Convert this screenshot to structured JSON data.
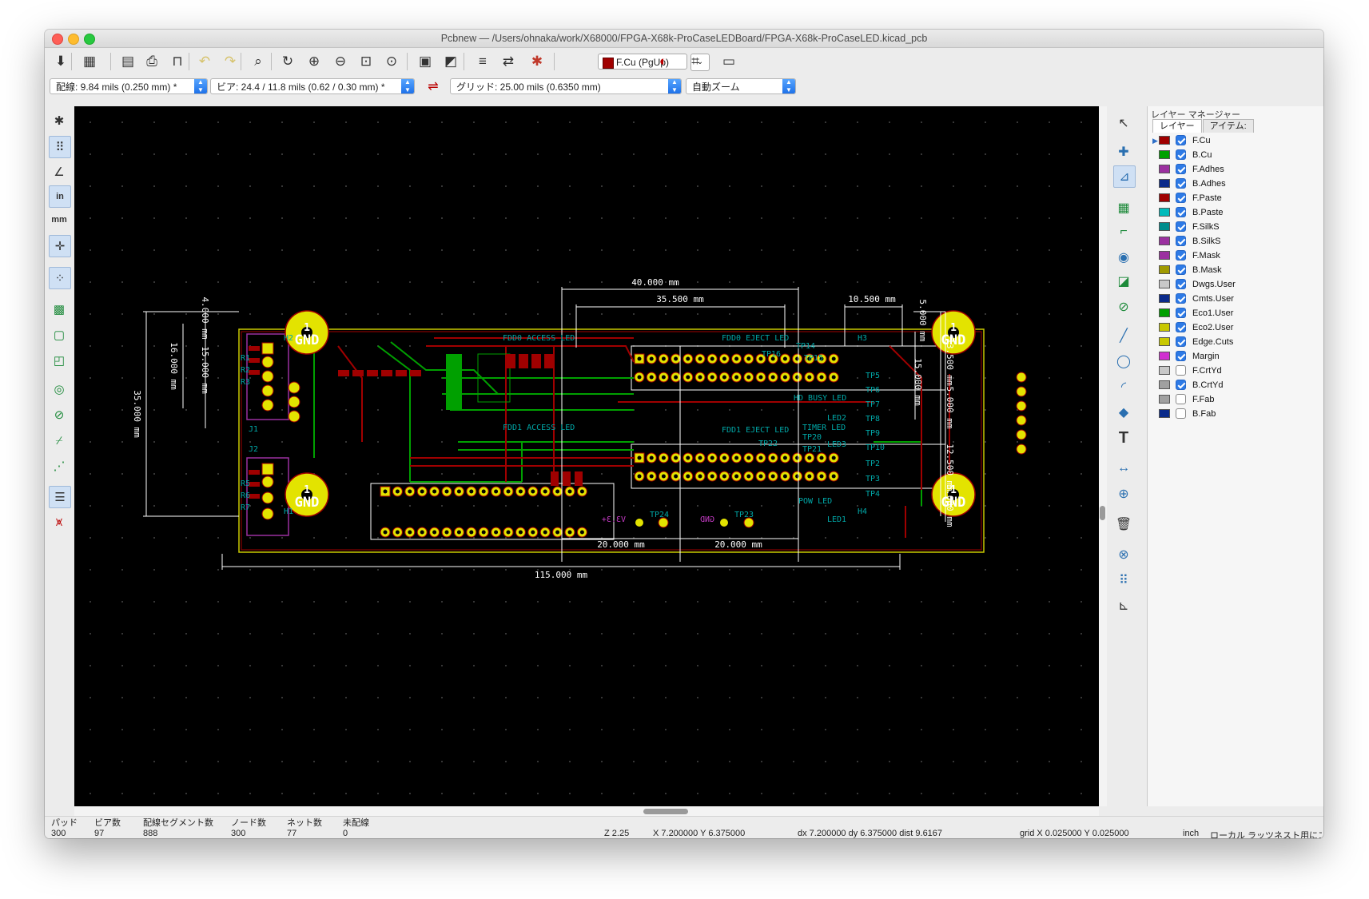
{
  "window": {
    "title": "Pcbnew — /Users/ohnaka/work/X68000/FPGA-X68k-ProCaseLEDBoard/FPGA-X68k-ProCaseLED.kicad_pcb"
  },
  "toolbar": {
    "buttons": [
      {
        "id": "save",
        "icon": "save-icon",
        "glyph": "⬇"
      },
      {
        "id": "board-setup",
        "icon": "board-setup-icon",
        "glyph": "▦"
      },
      {
        "id": "page-settings",
        "icon": "page-settings-icon",
        "glyph": "▤"
      },
      {
        "id": "print",
        "icon": "print-icon",
        "glyph": "⎙"
      },
      {
        "id": "plot",
        "icon": "plot-icon",
        "glyph": "⊓"
      },
      {
        "id": "undo",
        "icon": "undo-icon",
        "glyph": "↶"
      },
      {
        "id": "redo",
        "icon": "redo-icon",
        "glyph": "↷"
      },
      {
        "id": "find",
        "icon": "find-icon",
        "glyph": "⌕"
      },
      {
        "id": "redraw",
        "icon": "redraw-icon",
        "glyph": "↻"
      },
      {
        "id": "zoom-in",
        "icon": "zoom-in-icon",
        "glyph": "⊕"
      },
      {
        "id": "zoom-out",
        "icon": "zoom-out-icon",
        "glyph": "⊖"
      },
      {
        "id": "zoom-fit",
        "icon": "zoom-fit-icon",
        "glyph": "⊡"
      },
      {
        "id": "zoom-selection",
        "icon": "zoom-selection-icon",
        "glyph": "⊙"
      },
      {
        "id": "footprint-editor",
        "icon": "footprint-editor-icon",
        "glyph": "▣"
      },
      {
        "id": "footprint-browser",
        "icon": "footprint-browser-icon",
        "glyph": "◩"
      },
      {
        "id": "netlist",
        "icon": "netlist-icon",
        "glyph": "≡"
      },
      {
        "id": "update-pcb",
        "icon": "update-pcb-icon",
        "glyph": "⇄"
      },
      {
        "id": "drc",
        "icon": "drc-icon",
        "glyph": "✱"
      }
    ],
    "active_layer": "F.Cu (PgUp)",
    "extra_buttons": [
      {
        "id": "layer-pair",
        "icon": "layer-pair-icon",
        "glyph": "◐"
      },
      {
        "id": "autoroute",
        "icon": "autoroute-icon",
        "glyph": "⌗"
      },
      {
        "id": "scripting",
        "icon": "scripting-console-icon",
        "glyph": "▭"
      }
    ]
  },
  "toolbar2": {
    "track_width": "配線: 9.84 mils (0.250 mm) *",
    "via_size": "ビア: 24.4 / 11.8 mils (0.62 / 0.30 mm) *",
    "grid": "グリッド: 25.00 mils (0.6350 mm)",
    "zoom": "自動ズーム"
  },
  "left_toolbar": [
    {
      "id": "drc-markers",
      "icon": "drc-marker-icon",
      "glyph": "✱",
      "active": false
    },
    {
      "id": "grid",
      "icon": "grid-icon",
      "glyph": "⠿",
      "active": true
    },
    {
      "id": "polar",
      "icon": "polar-coords-icon",
      "glyph": "∠",
      "active": false
    },
    {
      "id": "inches",
      "icon": "inch-units-icon",
      "glyph": "in",
      "active": true
    },
    {
      "id": "mm",
      "icon": "mm-units-icon",
      "glyph": "mm",
      "active": false
    },
    {
      "id": "cursor",
      "icon": "full-cursor-icon",
      "glyph": "✛",
      "active": true
    },
    {
      "id": "ratsnest",
      "icon": "ratsnest-icon",
      "glyph": "⁘",
      "active": true
    },
    {
      "id": "zone-fill",
      "icon": "zone-fill-icon",
      "glyph": "▩",
      "active": false
    },
    {
      "id": "zone-outline",
      "icon": "zone-outline-icon",
      "glyph": "▢",
      "active": false
    },
    {
      "id": "zone-hide",
      "icon": "zone-hide-icon",
      "glyph": "◰",
      "active": false
    },
    {
      "id": "pad-sketch",
      "icon": "pad-sketch-icon",
      "glyph": "◎",
      "active": false
    },
    {
      "id": "via-sketch",
      "icon": "via-sketch-icon",
      "glyph": "⊘",
      "active": false
    },
    {
      "id": "track-sketch",
      "icon": "track-sketch-icon",
      "glyph": "⌿",
      "active": false
    },
    {
      "id": "high-contrast",
      "icon": "high-contrast-icon",
      "glyph": "⋰",
      "active": false
    },
    {
      "id": "layers-manager",
      "icon": "layers-manager-icon",
      "glyph": "☰",
      "active": true
    },
    {
      "id": "microwave",
      "icon": "microwave-icon",
      "glyph": "⩙",
      "active": false
    }
  ],
  "right_toolbar": [
    {
      "id": "select",
      "icon": "cursor-arrow-icon",
      "glyph": "↖",
      "active": false
    },
    {
      "id": "highlight-net",
      "icon": "highlight-net-icon",
      "glyph": "✚",
      "active": false
    },
    {
      "id": "local-ratsnest",
      "icon": "local-ratsnest-icon",
      "glyph": "⊿",
      "active": true
    },
    {
      "id": "add-footprint",
      "icon": "add-footprint-icon",
      "glyph": "▦",
      "active": false
    },
    {
      "id": "route-track",
      "icon": "route-track-icon",
      "glyph": "⌐",
      "active": false
    },
    {
      "id": "add-via",
      "icon": "add-via-icon",
      "glyph": "◉",
      "active": false
    },
    {
      "id": "add-zone",
      "icon": "add-zone-icon",
      "glyph": "◪",
      "active": false
    },
    {
      "id": "keepout",
      "icon": "keepout-icon",
      "glyph": "⊘",
      "active": false
    },
    {
      "id": "add-line",
      "icon": "add-line-icon",
      "glyph": "╱",
      "active": false
    },
    {
      "id": "add-circle",
      "icon": "add-circle-icon",
      "glyph": "◯",
      "active": false
    },
    {
      "id": "add-arc",
      "icon": "add-arc-icon",
      "glyph": "◜",
      "active": false
    },
    {
      "id": "add-polygon",
      "icon": "add-polygon-icon",
      "glyph": "◆",
      "active": false
    },
    {
      "id": "add-text",
      "icon": "add-text-icon",
      "glyph": "T",
      "active": false
    },
    {
      "id": "add-dimension",
      "icon": "add-dimension-icon",
      "glyph": "↔",
      "active": false
    },
    {
      "id": "add-target",
      "icon": "add-target-icon",
      "glyph": "⊕",
      "active": false
    },
    {
      "id": "delete",
      "icon": "delete-icon",
      "glyph": "🗑",
      "active": false
    },
    {
      "id": "drill-origin",
      "icon": "drill-origin-icon",
      "glyph": "⊗",
      "active": false
    },
    {
      "id": "grid-origin",
      "icon": "grid-origin-icon",
      "glyph": "⠿",
      "active": false
    },
    {
      "id": "measure",
      "icon": "measure-icon",
      "glyph": "⊾",
      "active": false
    }
  ],
  "layer_manager": {
    "title": "レイヤー マネージャー",
    "tabs": [
      "レイヤー",
      "アイテム:"
    ],
    "layers": [
      {
        "name": "F.Cu",
        "color": "#a00000",
        "visible": true,
        "active": true
      },
      {
        "name": "B.Cu",
        "color": "#00a000",
        "visible": true,
        "active": false
      },
      {
        "name": "F.Adhes",
        "color": "#9b30a0",
        "visible": true,
        "active": false
      },
      {
        "name": "B.Adhes",
        "color": "#0a2a8a",
        "visible": true,
        "active": false
      },
      {
        "name": "F.Paste",
        "color": "#a00000",
        "visible": true,
        "active": false
      },
      {
        "name": "B.Paste",
        "color": "#00bbbb",
        "visible": true,
        "active": false
      },
      {
        "name": "F.SilkS",
        "color": "#008c8c",
        "visible": true,
        "active": false
      },
      {
        "name": "B.SilkS",
        "color": "#9b30a0",
        "visible": true,
        "active": false
      },
      {
        "name": "F.Mask",
        "color": "#9b30a0",
        "visible": true,
        "active": false
      },
      {
        "name": "B.Mask",
        "color": "#a09a00",
        "visible": true,
        "active": false
      },
      {
        "name": "Dwgs.User",
        "color": "#c8c8c8",
        "visible": true,
        "active": false
      },
      {
        "name": "Cmts.User",
        "color": "#0a2a8a",
        "visible": true,
        "active": false
      },
      {
        "name": "Eco1.User",
        "color": "#00a000",
        "visible": true,
        "active": false
      },
      {
        "name": "Eco2.User",
        "color": "#c8c800",
        "visible": true,
        "active": false
      },
      {
        "name": "Edge.Cuts",
        "color": "#c8c800",
        "visible": true,
        "active": false
      },
      {
        "name": "Margin",
        "color": "#d030d0",
        "visible": true,
        "active": false
      },
      {
        "name": "F.CrtYd",
        "color": "#c8c8c8",
        "visible": false,
        "active": false
      },
      {
        "name": "B.CrtYd",
        "color": "#a0a0a0",
        "visible": true,
        "active": false
      },
      {
        "name": "F.Fab",
        "color": "#a0a0a0",
        "visible": false,
        "active": false
      },
      {
        "name": "B.Fab",
        "color": "#0a2a8a",
        "visible": false,
        "active": false
      }
    ]
  },
  "pcb": {
    "dimensions": {
      "d40": "40.000 mm",
      "d35_5": "35.500 mm",
      "d10_5": "10.500 mm",
      "d4": "4.000 mm",
      "d16": "16.000 mm",
      "d15l": "15.000 mm",
      "d35": "35.000 mm",
      "d5top": "5.000 mm",
      "d13_5": "13.500 mm",
      "d15r": "15.000 mm",
      "d5mid": "5.000 mm",
      "d12_5": "12.500 mm",
      "d5bot": "5.000 mm",
      "d20a": "20.000 mm",
      "d20b": "20.000 mm",
      "d115": "115.000 mm"
    },
    "labels": {
      "gnd": "GND",
      "pad1": "1",
      "fdd0_access": "FDD0 ACCESS LED",
      "fdd0_eject": "FDD0 EJECT LED",
      "fdd1_access": "FDD1 ACCESS LED",
      "fdd1_eject": "FDD1 EJECT LED",
      "timer_led": "TIMER LED",
      "pow_led": "POW LED",
      "hd_busy": "HD BUSY LED",
      "v33": "V3.3+",
      "gnd_mirror": "GND",
      "tp24": "TP24",
      "tp23": "TP23",
      "h1": "H1",
      "h2": "H2",
      "h3": "H3",
      "h4": "H4",
      "r1": "R1",
      "r2": "R2",
      "r3": "R3",
      "r5": "R5",
      "r6": "R6",
      "r7": "R7",
      "j1": "J1",
      "j2": "J2",
      "tp5": "TP5",
      "tp6": "TP6",
      "tp7": "TP7",
      "tp8": "TP8",
      "tp9": "TP9",
      "tp10": "TP10",
      "tp2": "TP2",
      "tp3": "TP3",
      "tp4": "TP4",
      "tp14": "TP14",
      "tp15": "TP15",
      "tp16": "TP16",
      "tp20": "TP20",
      "tp21": "TP21",
      "tp22": "TP22",
      "led1": "LED1",
      "led2": "LED2",
      "led3": "LED3"
    }
  },
  "status": {
    "pads_label": "パッド",
    "pads": "300",
    "vias_label": "ビア数",
    "vias": "97",
    "segments_label": "配線セグメント数",
    "segments": "888",
    "nodes_label": "ノード数",
    "nodes": "300",
    "nets_label": "ネット数",
    "nets": "77",
    "unrouted_label": "未配線",
    "unrouted": "0",
    "zoom": "Z 2.25",
    "xy": "X 7.200000  Y 6.375000",
    "delta": "dx 7.200000  dy 6.375000  dist 9.6167",
    "grid": "grid X 0.025000  Y 0.025000",
    "units": "inch",
    "hint": "ローカル ラッツネスト用にコ"
  }
}
